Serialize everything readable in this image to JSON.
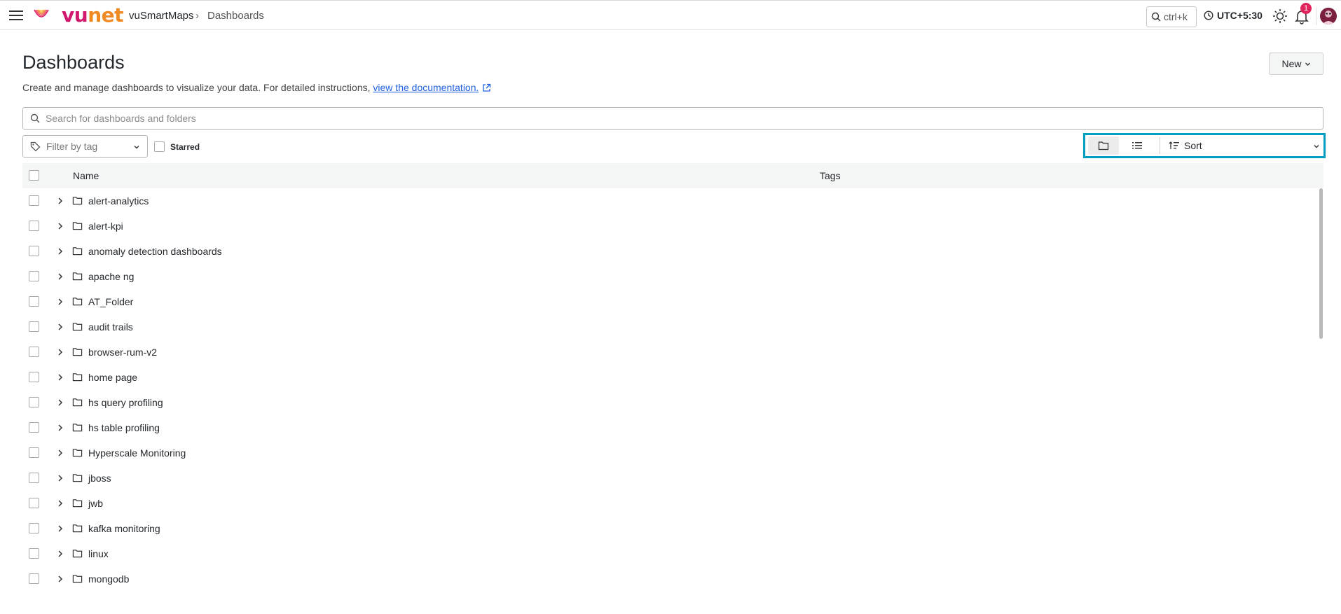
{
  "header": {
    "brand_left": "vu",
    "brand_right": "net",
    "breadcrumb_root": "vuSmartMaps",
    "breadcrumb_sep": "›",
    "breadcrumb_current": "Dashboards",
    "search_shortcut": "ctrl+k",
    "timezone": "UTC+5:30",
    "notification_count": "1",
    "icons": [
      "menu-icon",
      "logo-icon",
      "search-icon",
      "clock-icon",
      "sun-icon",
      "bell-icon",
      "avatar"
    ]
  },
  "page": {
    "title": "Dashboards",
    "description": "Create and manage dashboards to visualize your data. For detailed instructions, ",
    "doc_link": "view the documentation.",
    "new_button": "New"
  },
  "search": {
    "placeholder": "Search for dashboards and folders"
  },
  "filters": {
    "tag_placeholder": "Filter by tag",
    "starred_label": "Starred",
    "sort_label": "Sort",
    "highlight_color": "#009fc0"
  },
  "table": {
    "columns": [
      "Name",
      "Tags"
    ],
    "rows": [
      "alert-analytics",
      "alert-kpi",
      "anomaly detection dashboards",
      "apache ng",
      "AT_Folder",
      "audit trails",
      "browser-rum-v2",
      "home page",
      "hs query profiling",
      "hs table profiling",
      "Hyperscale Monitoring",
      "jboss",
      "jwb",
      "kafka monitoring",
      "linux",
      "mongodb"
    ]
  }
}
